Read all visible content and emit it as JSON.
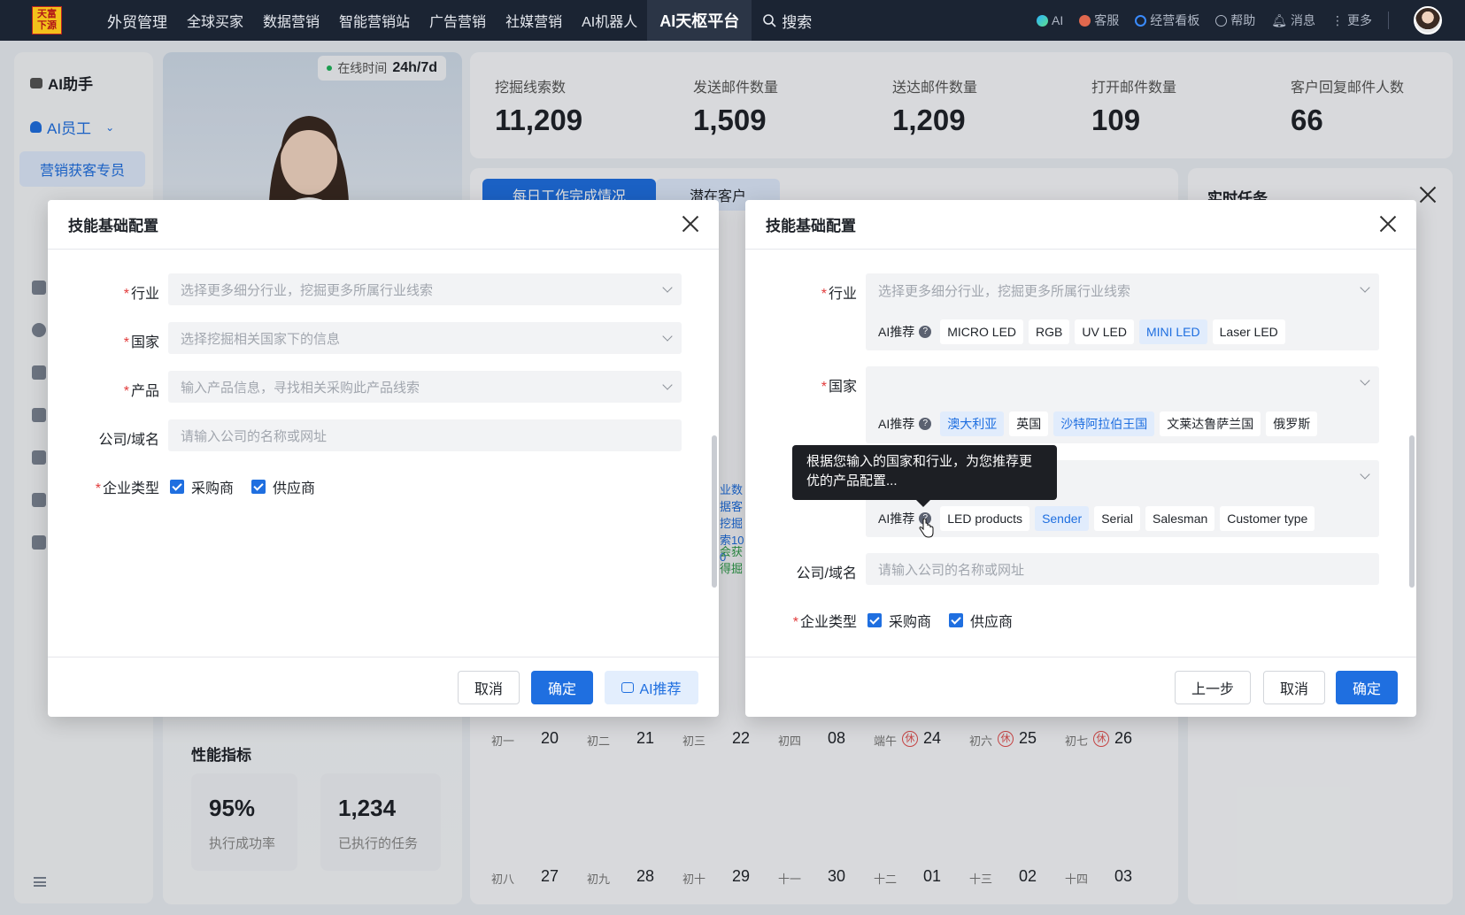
{
  "topbar": {
    "logo_text": "天富下源",
    "nav": [
      "外贸管理",
      "全球买家",
      "数据营销",
      "智能营销站",
      "广告营销",
      "社媒营销",
      "AI机器人"
    ],
    "nav_active": "AI天枢平台",
    "search": "搜索",
    "tools": [
      "AI",
      "客服",
      "经营看板",
      "帮助",
      "消息",
      "更多"
    ]
  },
  "sidebar": {
    "assistant": "AI助手",
    "employee": "AI员工",
    "specialist": "营销获客专员"
  },
  "profile": {
    "online_label": "在线时间",
    "online_value": "24h/7d",
    "perf_title": "性能指标",
    "perf": [
      {
        "value": "95%",
        "label": "执行成功率"
      },
      {
        "value": "1,234",
        "label": "已执行的任务"
      }
    ]
  },
  "stats": [
    {
      "label": "挖掘线索数",
      "value": "11,209"
    },
    {
      "label": "发送邮件数量",
      "value": "1,509"
    },
    {
      "label": "送达邮件数量",
      "value": "1,209"
    },
    {
      "label": "打开邮件数量",
      "value": "109"
    },
    {
      "label": "客户回复邮件人数",
      "value": "66"
    }
  ],
  "work": {
    "tab_daily": "每日工作完成情况",
    "tab_potential": "潜在客户",
    "calendar_row1": [
      {
        "lunar": "初一",
        "day": "20",
        "rest": ""
      },
      {
        "lunar": "初二",
        "day": "21",
        "rest": ""
      },
      {
        "lunar": "初三",
        "day": "22",
        "rest": ""
      },
      {
        "lunar": "初四",
        "day": "08",
        "rest": ""
      },
      {
        "lunar": "端午",
        "day": "24",
        "rest": "休"
      },
      {
        "lunar": "初六",
        "day": "25",
        "rest": "休"
      },
      {
        "lunar": "初七",
        "day": "26",
        "rest": "休"
      }
    ],
    "calendar_row2": [
      {
        "lunar": "初八",
        "day": "27"
      },
      {
        "lunar": "初九",
        "day": "28"
      },
      {
        "lunar": "初十",
        "day": "29"
      },
      {
        "lunar": "十一",
        "day": "30"
      },
      {
        "lunar": "十二",
        "day": "01"
      },
      {
        "lunar": "十三",
        "day": "02"
      },
      {
        "lunar": "十四",
        "day": "03"
      }
    ],
    "peek_blue": "业数据客挖掘索100",
    "peek_green": "会获得掘线索"
  },
  "tasks": {
    "title": "实时任务"
  },
  "modal_left": {
    "title": "技能基础配置",
    "fields": {
      "industry_label": "行业",
      "industry_placeholder": "选择更多细分行业，挖掘更多所属行业线索",
      "country_label": "国家",
      "country_placeholder": "选择挖掘相关国家下的信息",
      "product_label": "产品",
      "product_placeholder": "输入产品信息，寻找相关采购此产品线索",
      "company_label": "公司/域名",
      "company_placeholder": "请输入公司的名称或网址",
      "type_label": "企业类型",
      "buyer": "采购商",
      "supplier": "供应商"
    },
    "cancel": "取消",
    "confirm": "确定",
    "ai_recommend": "AI推荐"
  },
  "modal_right": {
    "title": "技能基础配置",
    "industry_label": "行业",
    "industry_placeholder": "选择更多细分行业，挖掘更多所属行业线索",
    "ai_rec_label": "AI推荐",
    "industry_tags": [
      {
        "text": "MICRO LED",
        "selected": false
      },
      {
        "text": "RGB",
        "selected": false
      },
      {
        "text": "UV LED",
        "selected": false
      },
      {
        "text": "MINI LED",
        "selected": true
      },
      {
        "text": "Laser LED",
        "selected": false
      }
    ],
    "country_label": "国家",
    "country_tags": [
      {
        "text": "澳大利亚",
        "selected": true
      },
      {
        "text": "英国",
        "selected": false
      },
      {
        "text": "沙特阿拉伯王国",
        "selected": true
      },
      {
        "text": "文莱达鲁萨兰国",
        "selected": false
      },
      {
        "text": "俄罗斯",
        "selected": false
      }
    ],
    "product_tags": [
      {
        "text": "LED products",
        "selected": false
      },
      {
        "text": "Sender",
        "selected": true
      },
      {
        "text": "Serial",
        "selected": false
      },
      {
        "text": "Salesman",
        "selected": false
      },
      {
        "text": "Customer type",
        "selected": false
      }
    ],
    "tooltip": "根据您输入的国家和行业，为您推荐更优的产品配置...",
    "company_label": "公司/域名",
    "company_placeholder": "请输入公司的名称或网址",
    "type_label": "企业类型",
    "buyer": "采购商",
    "supplier": "供应商",
    "prev": "上一步",
    "cancel": "取消",
    "confirm": "确定"
  }
}
